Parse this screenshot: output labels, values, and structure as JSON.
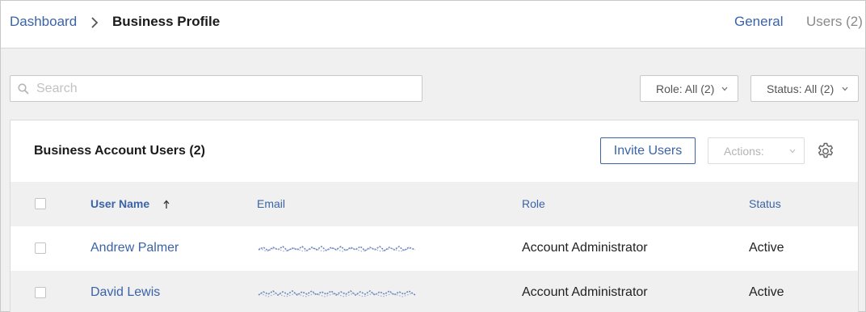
{
  "breadcrumb": {
    "parent": "Dashboard",
    "current": "Business Profile"
  },
  "tabs": {
    "general": "General",
    "users": "Users (2)"
  },
  "search": {
    "placeholder": "Search",
    "value": ""
  },
  "filters": {
    "role": "Role: All (2)",
    "status": "Status: All (2)"
  },
  "panel": {
    "title": "Business Account Users (2)",
    "invite_label": "Invite Users",
    "actions_label": "Actions:"
  },
  "table": {
    "columns": {
      "name": "User Name",
      "email": "Email",
      "role": "Role",
      "status": "Status"
    },
    "sort": "ascending",
    "rows": [
      {
        "name": "Andrew Palmer",
        "email": "[redacted]",
        "role": "Account Administrator",
        "status": "Active"
      },
      {
        "name": "David Lewis",
        "email": "[redacted]",
        "role": "Account Administrator",
        "status": "Active"
      }
    ]
  },
  "icons": {
    "chevron_right": "chevron-right-icon",
    "search": "search-icon",
    "chevron_down": "chevron-down-icon",
    "gear": "gear-icon",
    "sort": "sort-ascending-icon"
  },
  "colors": {
    "link": "#3b63a8",
    "background": "#f0f0f0",
    "panel": "#ffffff"
  }
}
